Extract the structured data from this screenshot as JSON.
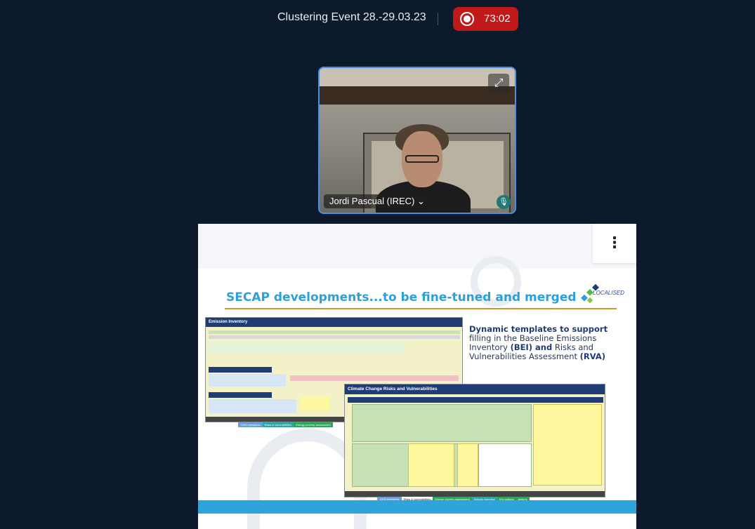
{
  "meeting": {
    "title": "Clustering Event 28.-29.03.23",
    "recording_time": "73:02"
  },
  "participant": {
    "name": "Jordi Pascual (IREC)",
    "chevron": "⌄",
    "icons": {
      "expand": "expand-icon",
      "mic": "microphone-icon"
    }
  },
  "share": {
    "menu_label": "⋮",
    "slide": {
      "title": "SECAP developments...to be fine-tuned and merged",
      "logo_text": "LOCALISED",
      "desc_1": "Dynamic templates to support",
      "desc_2": "filling in the Baseline Emissions Inventory",
      "desc_3": "(BEI) and",
      "desc_4": "Risks and Vulnerabilities Assessment",
      "desc_5": "(RVA)",
      "sheet1_title": "Emission Inventory",
      "sheet2_title": "Climate Change Risks and Vulnerabilities",
      "sheet1_tabs": [
        "Dashboard",
        "Strategy",
        "GHG emissions",
        "Risks & vulnerabilities",
        "Energy poverty assessment"
      ],
      "sheet2_tabs": [
        "Dashboard",
        "Strategy",
        "GHG emissions",
        "Risks & vulnerabilities",
        "Energy poverty assessment",
        "Actions overview",
        "Key actions",
        "Actions"
      ]
    }
  },
  "colors": {
    "background": "#0d1a2b",
    "record": "#c0191a",
    "tile_border": "#4a8ee6",
    "slide_title": "#2f9fd8",
    "accent_bar": "#2fa3dc"
  }
}
